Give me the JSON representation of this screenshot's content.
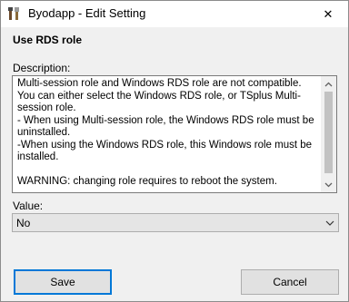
{
  "window": {
    "title": "Byodapp - Edit Setting",
    "close_glyph": "✕"
  },
  "setting": {
    "name": "Use RDS role"
  },
  "description": {
    "label": "Description:",
    "text": "Multi-session role and Windows RDS role are not compatible. You can either select the Windows RDS role, or TSplus Multi-session role.\n- When using Multi-session role, the Windows RDS role must be uninstalled.\n-When using the Windows RDS role, this Windows role must be installed.\n\nWARNING: changing role requires to reboot the system."
  },
  "value": {
    "label": "Value:",
    "selected": "No"
  },
  "buttons": {
    "save_label": "Save",
    "cancel_label": "Cancel"
  },
  "colors": {
    "accent": "#0078d7",
    "window_bg": "#f0f0f0"
  }
}
